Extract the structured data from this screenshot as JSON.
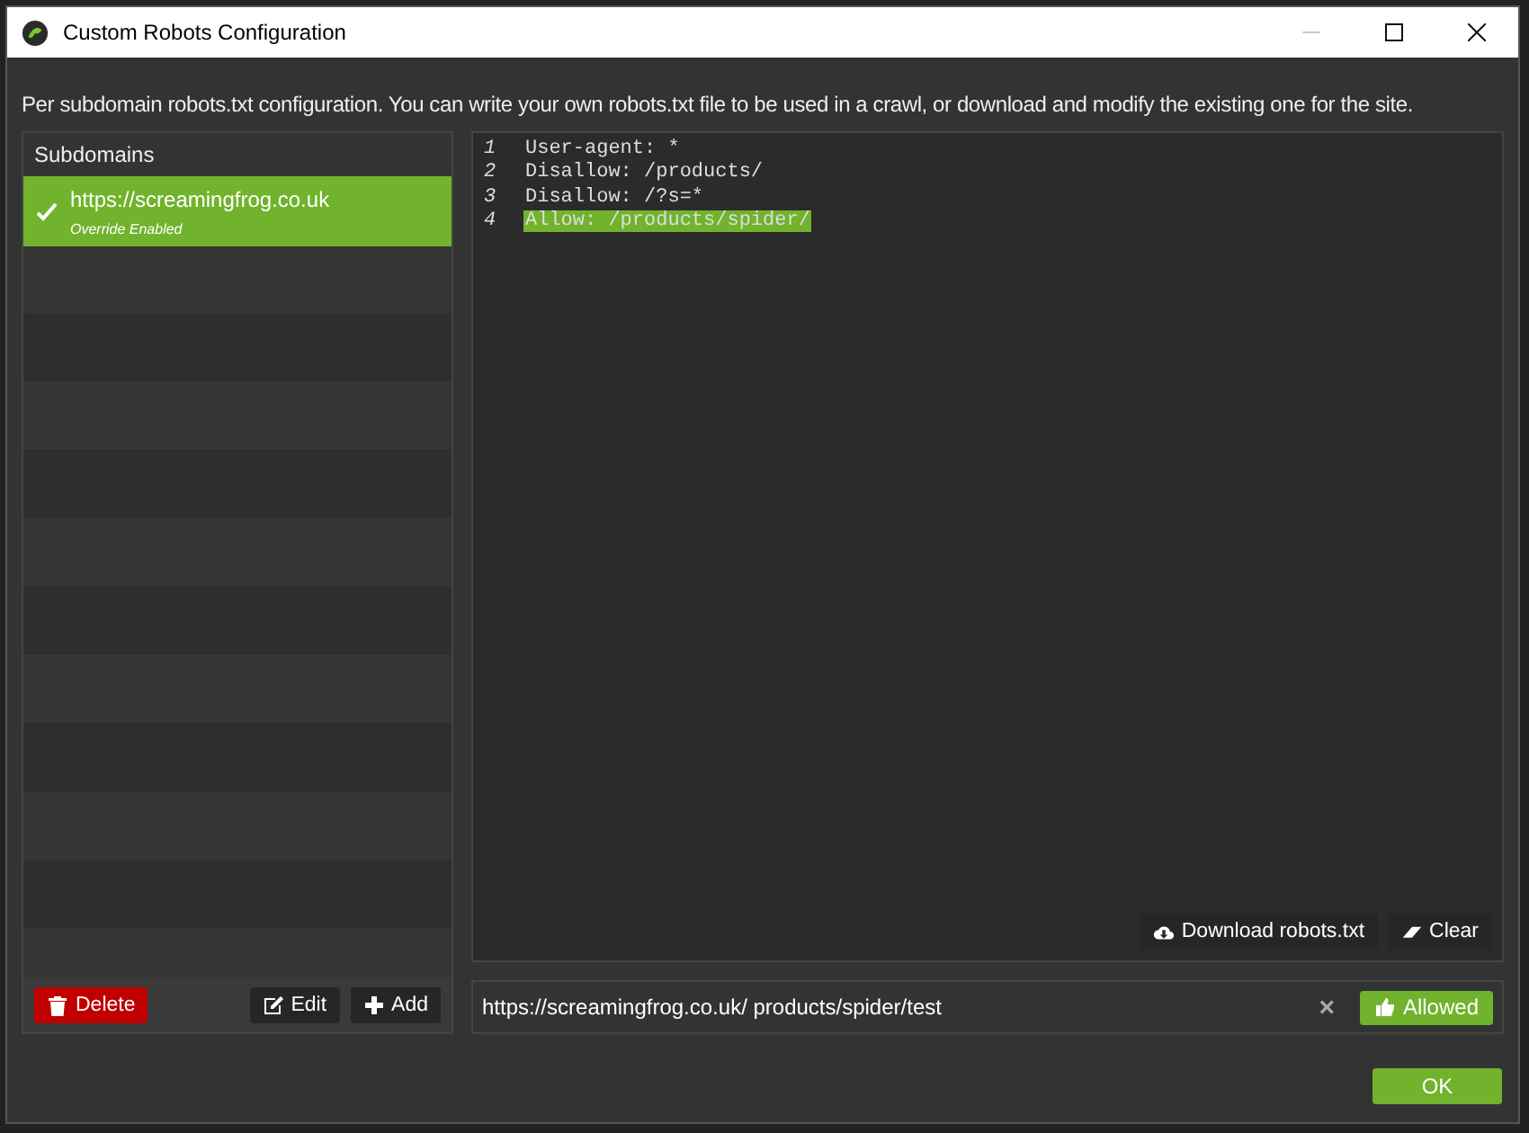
{
  "window": {
    "title": "Custom Robots Configuration",
    "minimize_disabled": true
  },
  "description": "Per subdomain robots.txt configuration. You can write your own robots.txt file to be used in a crawl, or download and modify the existing one for the site.",
  "subdomains": {
    "header": "Subdomains",
    "items": [
      {
        "url": "https://screamingfrog.co.uk",
        "note": "Override Enabled",
        "selected": true,
        "checked": true
      }
    ],
    "buttons": [
      {
        "label": "Delete",
        "kind": "delete"
      },
      {
        "label": "Edit",
        "kind": "edit"
      },
      {
        "label": "Add",
        "kind": "add"
      }
    ]
  },
  "editor": {
    "lines": [
      {
        "number": "1",
        "text": "User-agent: *",
        "highlighted": false
      },
      {
        "number": "2",
        "text": "Disallow: /products/",
        "highlighted": false
      },
      {
        "number": "3",
        "text": "Disallow: /?s=*",
        "highlighted": false
      },
      {
        "number": "4",
        "text": "Allow: /products/spider/",
        "highlighted": true
      }
    ],
    "buttons": [
      {
        "label": "Download robots.txt",
        "kind": "download"
      },
      {
        "label": "Clear",
        "kind": "clear"
      }
    ]
  },
  "test": {
    "value": "https://screamingfrog.co.uk/ products/spider/test",
    "clear": "×",
    "result": "Allowed",
    "allowed": true
  },
  "ok": "OK"
}
